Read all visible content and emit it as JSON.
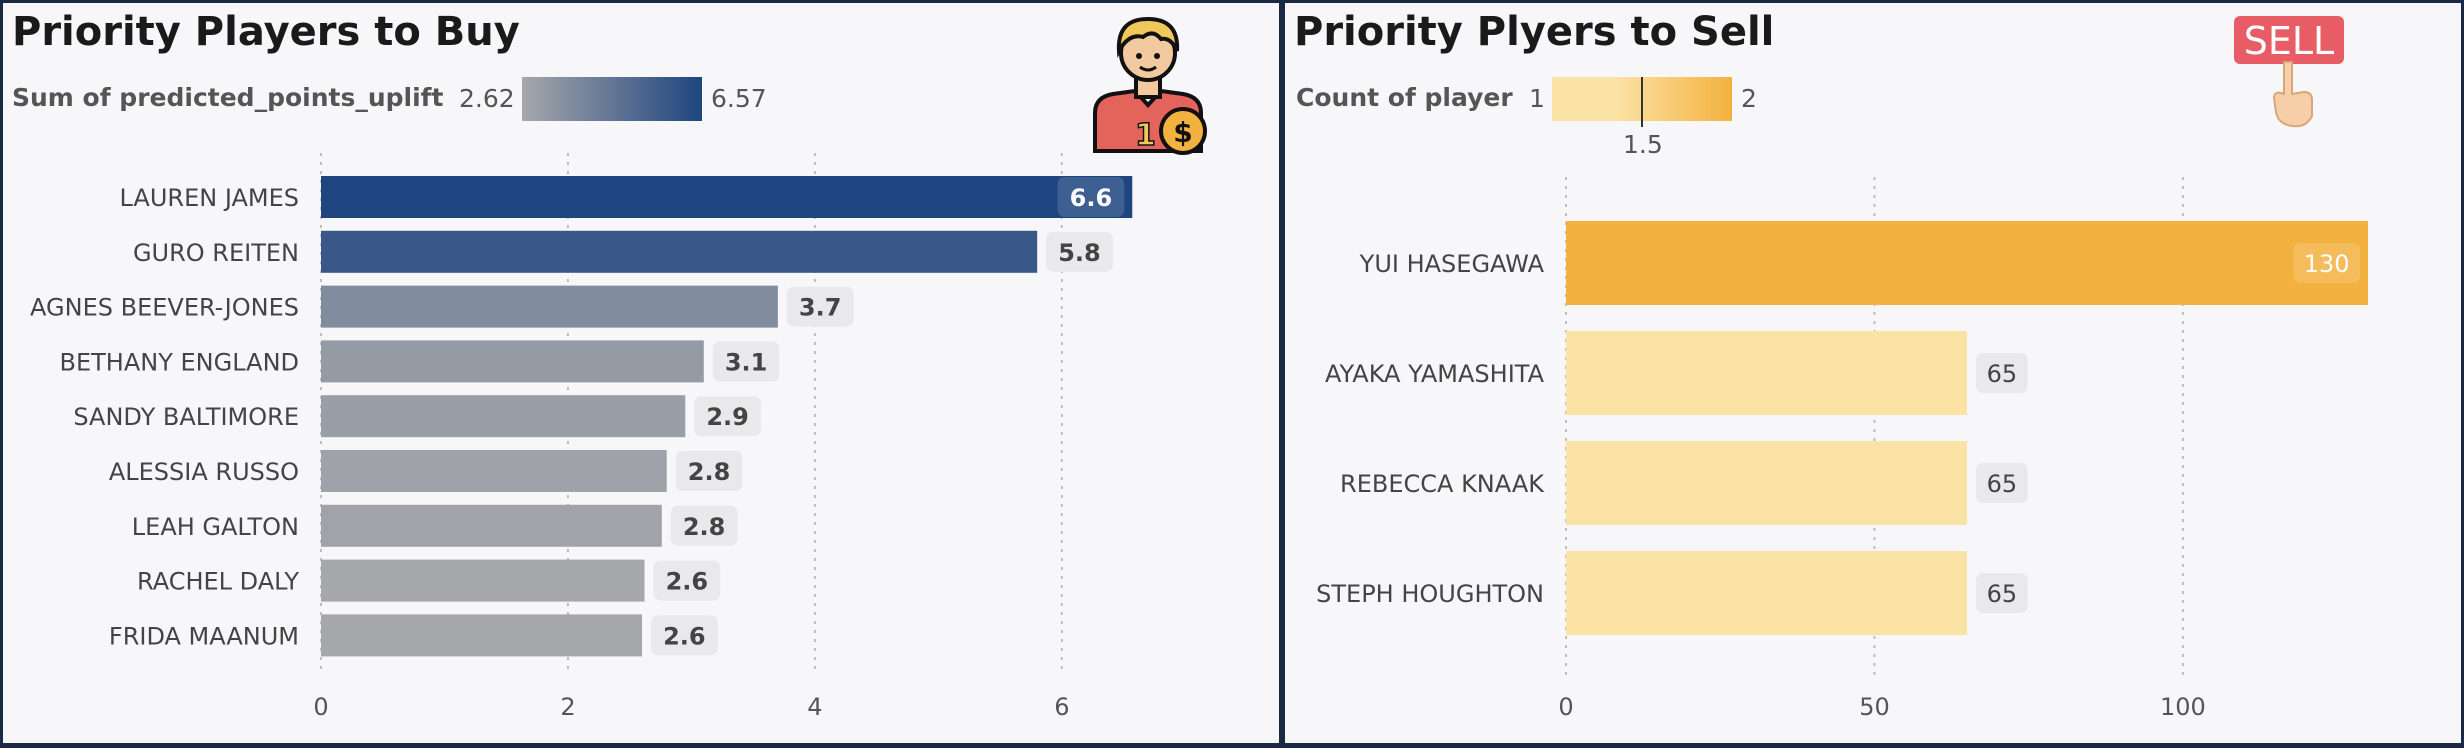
{
  "chart_data": [
    {
      "type": "bar",
      "orientation": "horizontal",
      "title": "Priority Players to Buy",
      "legend": {
        "label": "Sum of predicted_points_uplift",
        "min": "2.62",
        "max": "6.57"
      },
      "categories": [
        "LAUREN JAMES",
        "GURO REITEN",
        "AGNES BEEVER-JONES",
        "BETHANY ENGLAND",
        "SANDY BALTIMORE",
        "ALESSIA RUSSO",
        "LEAH GALTON",
        "RACHEL DALY",
        "FRIDA MAANUM"
      ],
      "values": [
        6.57,
        5.8,
        3.7,
        3.1,
        2.95,
        2.8,
        2.76,
        2.62,
        2.6
      ],
      "labels": [
        "6.6",
        "5.8",
        "3.7",
        "3.1",
        "2.9",
        "2.8",
        "2.8",
        "2.6",
        "2.6"
      ],
      "xticks": [
        0,
        2,
        4,
        6
      ],
      "xlim": [
        0,
        6.9
      ],
      "grid": true,
      "colors": {
        "low": "#a6a7aa",
        "high": "#1f4580"
      }
    },
    {
      "type": "bar",
      "orientation": "horizontal",
      "title": "Priority Plyers to Sell",
      "legend": {
        "label": "Count of player",
        "min": "1",
        "mid": "1.5",
        "max": "2"
      },
      "categories": [
        "YUI HASEGAWA",
        "AYAKA YAMASHITA",
        "REBECCA KNAAK",
        "STEPH HOUGHTON"
      ],
      "values": [
        130,
        65,
        65,
        65
      ],
      "labels": [
        "130",
        "65",
        "65",
        "65"
      ],
      "xticks": [
        0,
        50,
        100
      ],
      "xlim": [
        0,
        130
      ],
      "grid": true,
      "colors": {
        "low": "#fbe3a6",
        "high": "#f3b23f"
      }
    }
  ],
  "badge": {
    "text": "SELL",
    "color": "#e85c66"
  }
}
